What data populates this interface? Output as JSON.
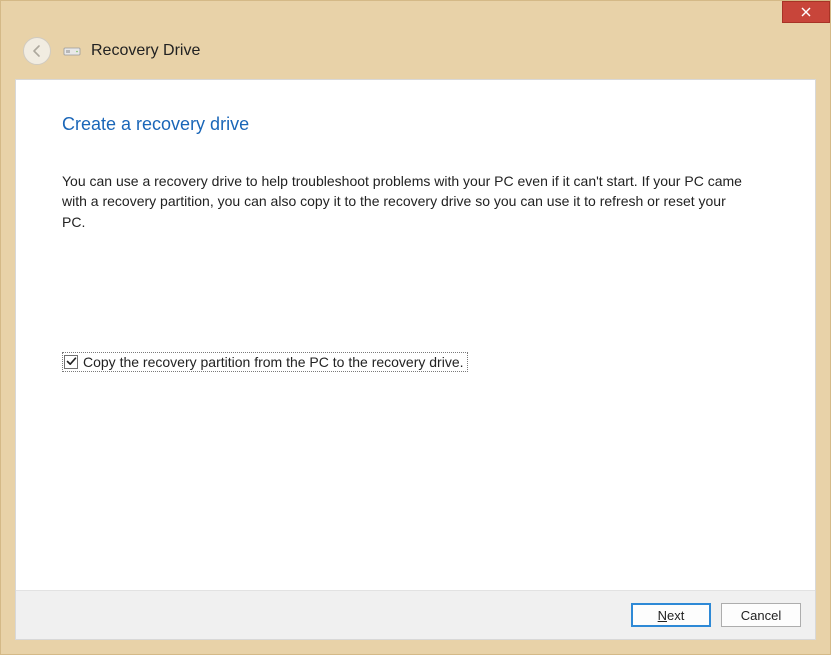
{
  "window": {
    "title": "Recovery Drive"
  },
  "page": {
    "heading": "Create a recovery drive",
    "description": "You can use a recovery drive to help troubleshoot problems with your PC even if it can't start. If your PC came with a recovery partition, you can also copy it to the recovery drive so you can use it to refresh or reset your PC."
  },
  "checkbox": {
    "checked": true,
    "label": "Copy the recovery partition from the PC to the recovery drive."
  },
  "buttons": {
    "next_prefix": "",
    "next_mnemonic": "N",
    "next_suffix": "ext",
    "cancel": "Cancel"
  }
}
